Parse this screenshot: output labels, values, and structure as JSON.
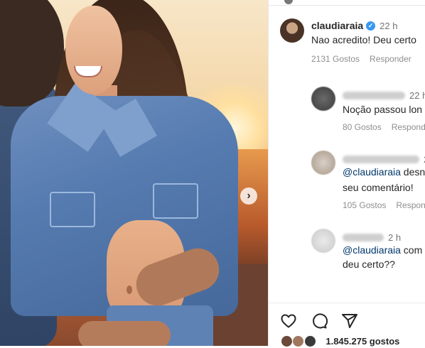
{
  "post": {
    "next_icon": "chevron-right",
    "colors": {
      "link": "#00376b",
      "verified": "#3897f0",
      "muted": "#737373"
    }
  },
  "comments": [
    {
      "username": "claudiaraia",
      "verified": true,
      "time": "22 h",
      "text": "Nao acredito! Deu certo",
      "likes": "2131 Gostos",
      "reply": "Responder"
    },
    {
      "username": "",
      "time": "22 h",
      "text": "Noção passou lon",
      "likes": "80 Gostos",
      "reply": "Respond"
    },
    {
      "username": "",
      "time": "2",
      "mention": "@claudiaraia",
      "text_rest": " desn",
      "text_line2": "seu comentário!",
      "likes": "105 Gostos",
      "reply": "Respon"
    },
    {
      "username": "",
      "time": "2 h",
      "mention": "@claudiaraia",
      "text_rest": " com",
      "text_line2": "deu certo??"
    }
  ],
  "actions": {
    "like_icon": "heart-icon",
    "comment_icon": "comment-bubble-icon",
    "share_icon": "paper-plane-icon"
  },
  "likes_total": "1.845.275 gostos"
}
